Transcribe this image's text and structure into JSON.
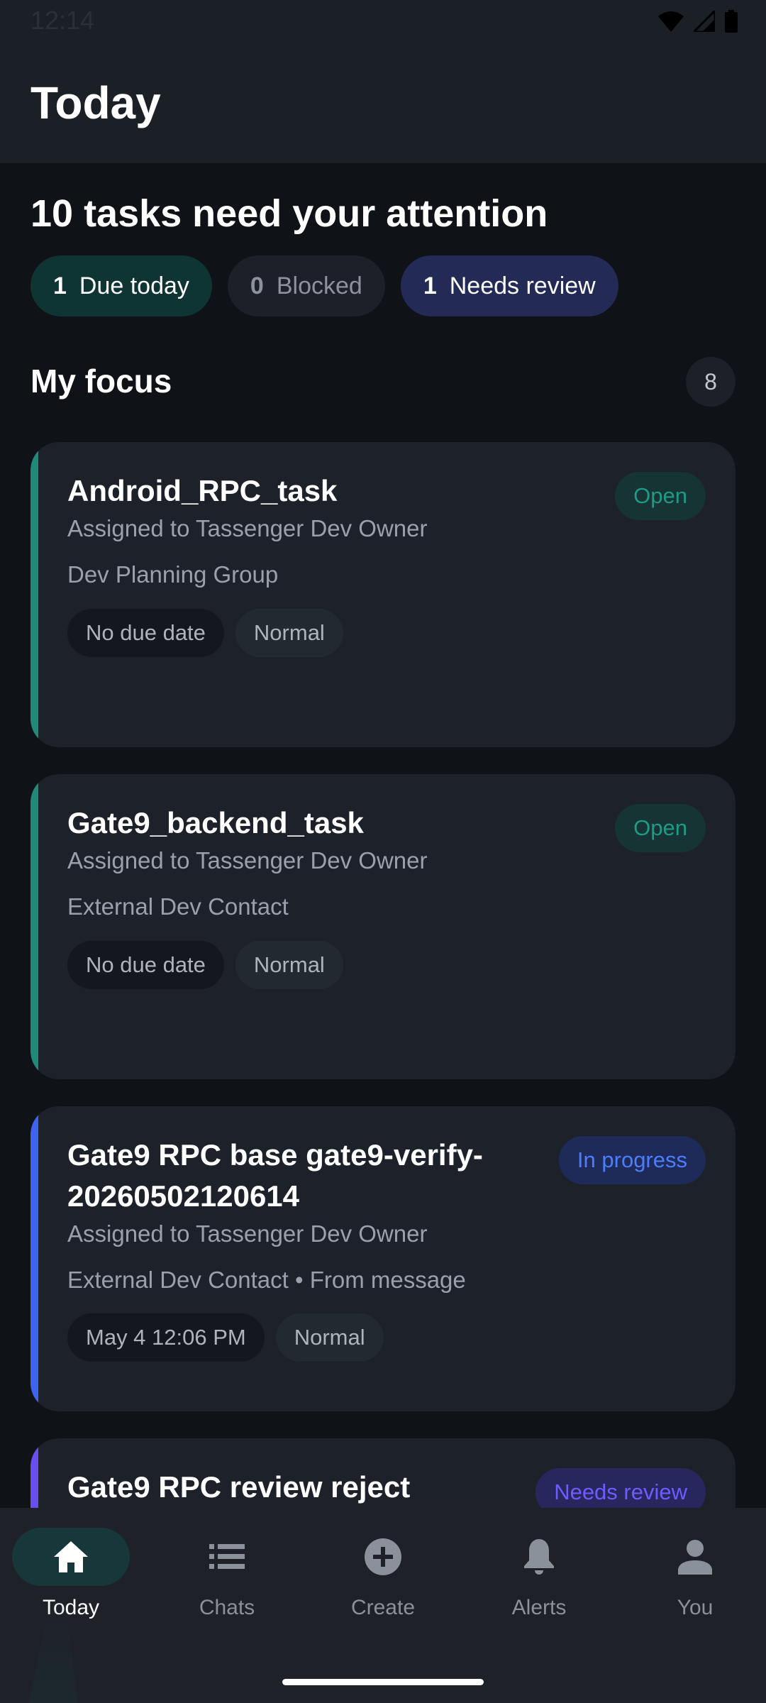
{
  "status_bar": {
    "time": "12:14"
  },
  "header": {
    "title": "Today"
  },
  "summary": {
    "title": "10 tasks need your attention",
    "chips": [
      {
        "count": "1",
        "label": "Due today"
      },
      {
        "count": "0",
        "label": "Blocked"
      },
      {
        "count": "1",
        "label": "Needs review"
      }
    ]
  },
  "focus": {
    "title": "My focus",
    "count": "8"
  },
  "tasks": [
    {
      "title": "Android_RPC_task",
      "assignee": "Assigned to Tassenger Dev Owner",
      "group": "Dev Planning Group",
      "due": "No due date",
      "priority": "Normal",
      "status": "Open"
    },
    {
      "title": "Gate9_backend_task",
      "assignee": "Assigned to Tassenger Dev Owner",
      "group": "External Dev Contact",
      "due": "No due date",
      "priority": "Normal",
      "status": "Open"
    },
    {
      "title": "Gate9 RPC base gate9-verify-20260502120614",
      "assignee": "Assigned to Tassenger Dev Owner",
      "group": "External Dev Contact • From message",
      "due": "May 4 12:06 PM",
      "priority": "Normal",
      "status": "In progress"
    },
    {
      "title": "Gate9 RPC review reject",
      "status": "Needs review"
    }
  ],
  "colors": {
    "accent_open": "#1f8a78",
    "accent_progress": "#3d63f0",
    "accent_review": "#6a4df0"
  },
  "nav": [
    {
      "label": "Today",
      "icon": "home-icon"
    },
    {
      "label": "Chats",
      "icon": "list-icon"
    },
    {
      "label": "Create",
      "icon": "add-circle-icon"
    },
    {
      "label": "Alerts",
      "icon": "bell-icon"
    },
    {
      "label": "You",
      "icon": "person-icon"
    }
  ]
}
